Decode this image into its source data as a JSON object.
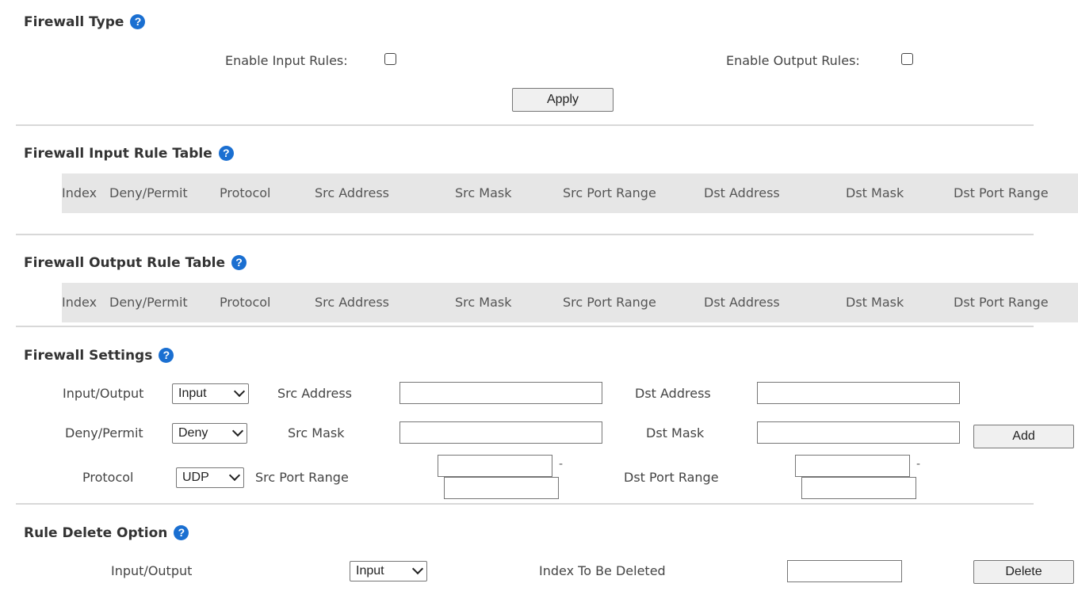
{
  "firewall_type": {
    "title": "Firewall Type",
    "enable_input_label": "Enable Input Rules:",
    "enable_output_label": "Enable Output Rules:",
    "apply_label": "Apply"
  },
  "input_table": {
    "title": "Firewall Input Rule Table",
    "columns": [
      "Index",
      "Deny/Permit",
      "Protocol",
      "Src Address",
      "Src Mask",
      "Src Port Range",
      "Dst Address",
      "Dst Mask",
      "Dst Port Range"
    ]
  },
  "output_table": {
    "title": "Firewall Output Rule Table",
    "columns": [
      "Index",
      "Deny/Permit",
      "Protocol",
      "Src Address",
      "Src Mask",
      "Src Port Range",
      "Dst Address",
      "Dst Mask",
      "Dst Port Range"
    ]
  },
  "settings": {
    "title": "Firewall Settings",
    "io_label": "Input/Output",
    "io_value": "Input",
    "deny_label": "Deny/Permit",
    "deny_value": "Deny",
    "protocol_label": "Protocol",
    "protocol_value": "UDP",
    "src_address_label": "Src Address",
    "src_mask_label": "Src Mask",
    "src_port_label": "Src Port Range",
    "dst_address_label": "Dst Address",
    "dst_mask_label": "Dst Mask",
    "dst_port_label": "Dst Port Range",
    "range_dash": "-",
    "add_label": "Add"
  },
  "delete_option": {
    "title": "Rule Delete Option",
    "io_label": "Input/Output",
    "io_value": "Input",
    "index_label": "Index To Be Deleted",
    "delete_label": "Delete"
  },
  "icons": {
    "help": "question-circle-icon",
    "chevron": "chevron-down-icon"
  },
  "colors": {
    "help_icon": "#1a6fd1",
    "table_header_bg": "#e6e6e6",
    "divider": "#d8d8d8"
  }
}
